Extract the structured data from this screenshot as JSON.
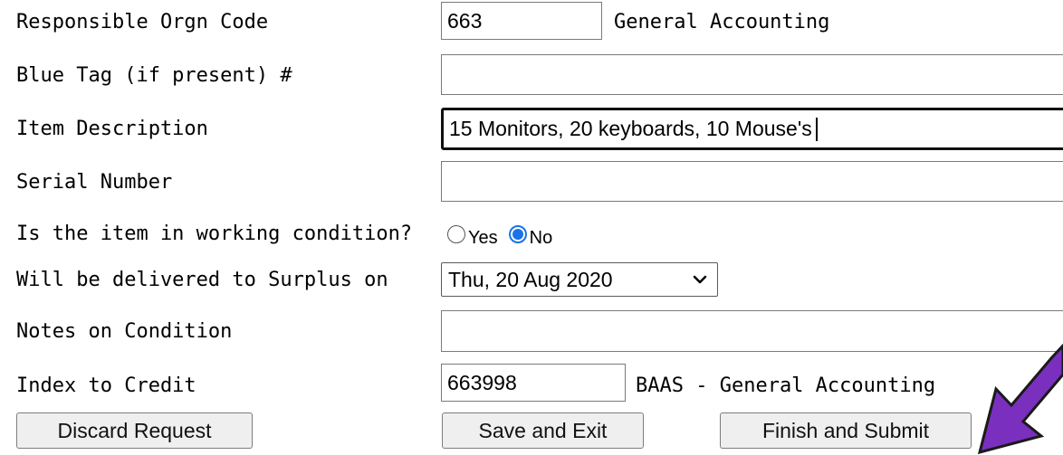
{
  "form": {
    "responsible_orgn_code": {
      "label": "Responsible Orgn Code",
      "value": "663",
      "org_name": "General Accounting"
    },
    "blue_tag": {
      "label": "Blue Tag (if present) #",
      "value": ""
    },
    "item_description": {
      "label": "Item Description",
      "value": "15 Monitors, 20 keyboards, 10 Mouse's"
    },
    "serial_number": {
      "label": "Serial Number",
      "value": ""
    },
    "working_condition": {
      "label": "Is the item in working condition?",
      "options": [
        "Yes",
        "No"
      ],
      "selected": "No"
    },
    "delivery_date": {
      "label": "Will be delivered to Surplus on",
      "selected": "Thu, 20 Aug 2020"
    },
    "notes_on_condition": {
      "label": "Notes on Condition",
      "value": ""
    },
    "index_to_credit": {
      "label": "Index to Credit",
      "value": "663998",
      "index_name": "BAAS - General Accounting"
    }
  },
  "buttons": {
    "discard": "Discard Request",
    "save_exit": "Save and Exit",
    "finish_submit": "Finish and Submit"
  },
  "annotation": {
    "arrow_color": "#7b2fbe",
    "arrow_icon": "pointer-arrow-icon"
  },
  "colors": {
    "radio_accent": "#1a73e8"
  }
}
